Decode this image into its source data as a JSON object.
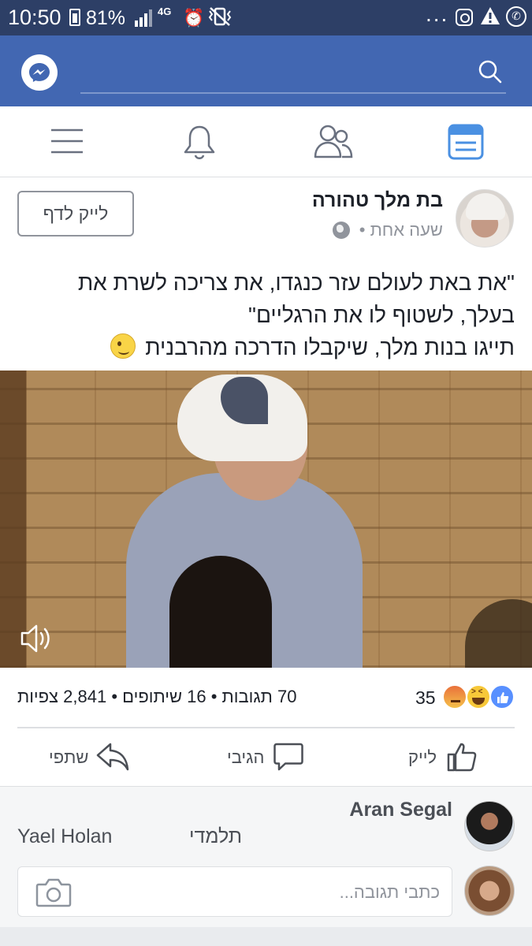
{
  "status_bar": {
    "time": "10:50",
    "battery": "81%",
    "network": "4G",
    "overflow": "...",
    "icons": [
      "battery-icon",
      "signal-icon",
      "alarm-icon",
      "vibrate-icon",
      "instagram-icon",
      "warning-icon",
      "whatsapp-icon"
    ]
  },
  "header": {
    "icons": [
      "messenger-icon",
      "search-icon"
    ],
    "search_placeholder": ""
  },
  "nav": {
    "items": [
      "news-feed-icon",
      "friend-requests-icon",
      "notifications-icon",
      "menu-icon"
    ],
    "active": "news-feed-icon"
  },
  "post": {
    "page_name": "בת מלך טהורה",
    "time": "שעה אחת",
    "separator": "•",
    "like_page": "לייק לדף",
    "text_line1": "\"את באת לעולם עזר כנגדו, את צריכה לשרת את",
    "text_line2": "בעלך, לשטוף לו את הרגליים\"",
    "text_line3": "תייגו בנות מלך, שיקבלו הדרכה מהרבנית",
    "reactions_count": "35",
    "stats": "70 תגובות • 16 שיתופים • 2,841 צפיות"
  },
  "actions": {
    "like": "לייק",
    "comment": "הגיבי",
    "share": "שתפי"
  },
  "comment": {
    "author": "Aran Segal",
    "text_mention": "Yael Holan",
    "text_rest": "תלמדי"
  },
  "composer": {
    "placeholder": "כתבי תגובה..."
  },
  "colors": {
    "status_bar": "#2d3f66",
    "brand": "#4267b2",
    "active_nav": "#4a90e2",
    "like_blue": "#5890ff"
  }
}
